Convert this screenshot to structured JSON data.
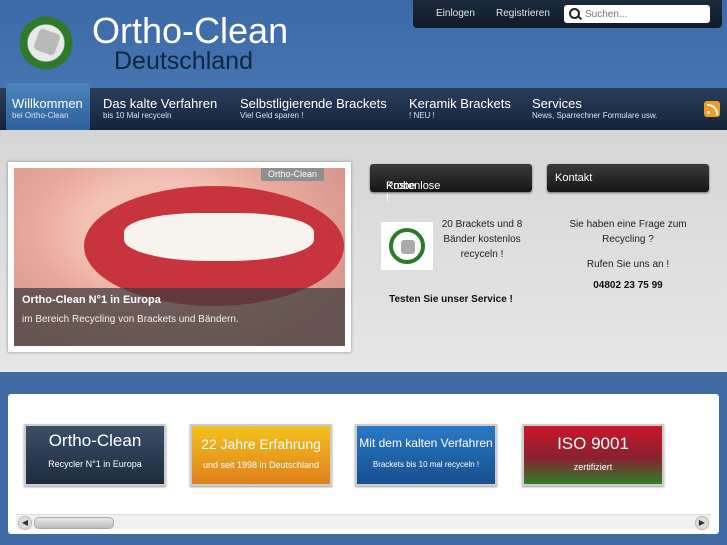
{
  "header": {
    "logo_title": "Ortho-Clean",
    "logo_subtitle": "Deutschland",
    "top_links": [
      "Einlogen",
      "Registrieren"
    ],
    "search_placeholder": "Suchen..."
  },
  "nav": [
    {
      "title": "Willkommen",
      "subtitle": "bei Ortho-Clean"
    },
    {
      "title": "Das kalte Verfahren",
      "subtitle": "bis 10 Mal recyceln"
    },
    {
      "title": "Selbstligierende Brackets",
      "subtitle": "Viel Geld sparen !"
    },
    {
      "title": "Keramik Brackets",
      "subtitle": "! NEU !"
    },
    {
      "title": "Services",
      "subtitle": "News, Sparrechner Formulare usw."
    }
  ],
  "slider": {
    "tag": "Ortho-Clean",
    "caption_title": "Ortho-Clean N°1 in Europa",
    "caption_text": "im Bereich Recycling von Brackets und Bändern."
  },
  "probe": {
    "heading_light": "Kostenlose ",
    "heading_bold": "Probe !",
    "text": "20 Brackets und 8 Bänder kostenlos recyceln !",
    "cta": "Testen Sie unser Service !"
  },
  "kontakt": {
    "heading": "Kontakt",
    "text": "Sie haben eine Frage zum Recycling ?",
    "call": "Rufen Sie uns an !",
    "phone": "04802 23 75 99"
  },
  "tiles": [
    {
      "title": "Ortho-Clean",
      "subtitle": "Recycler N°1 in Europa"
    },
    {
      "title": "22 Jahre Erfahrung",
      "subtitle": "und seit 1998 in Deutschland"
    },
    {
      "title": "Mit dem kalten Verfahren",
      "subtitle": "Brackets bis 10 mal recyceln !"
    },
    {
      "title": "ISO 9001",
      "subtitle": "zertifiziert"
    }
  ],
  "colors": {
    "page_blue": "#3f6aa3",
    "nav_dark": "#14243a",
    "tile_orange": "#e39a1f",
    "tile_blue": "#1f5fa0",
    "tile_red_green": "#b3182a"
  },
  "icons": [
    "search-icon",
    "rss-icon",
    "scroll-left-icon",
    "scroll-right-icon"
  ]
}
